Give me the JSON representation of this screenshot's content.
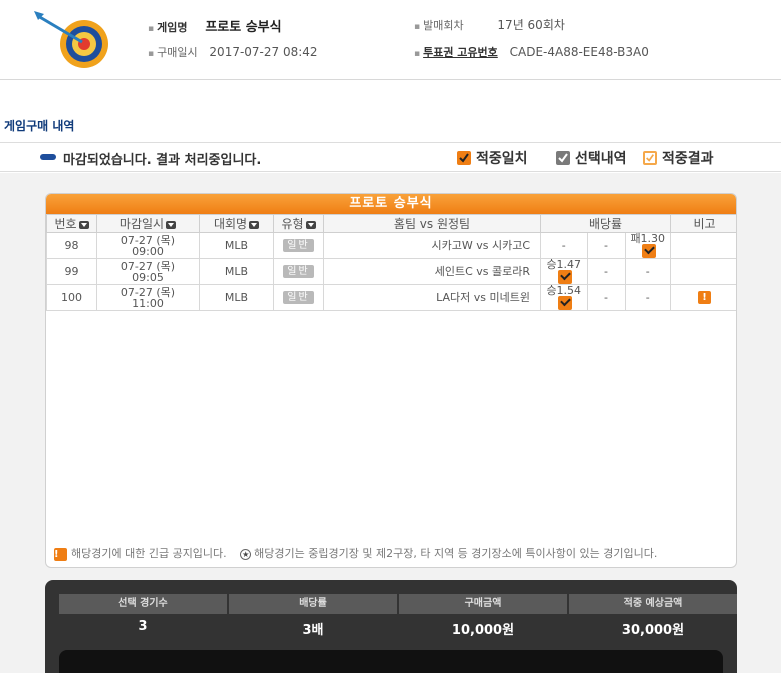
{
  "header": {
    "game_name_label": "게임명",
    "game_name_value": "프로토 승부식",
    "round_label": "발매회차",
    "round_value": "17년 60회차",
    "purchase_date_label": "구매일시",
    "purchase_date_value": "2017-07-27 08:42",
    "ticket_id_label": "투표권 고유번호",
    "ticket_id_value": "CADE-4A88-EE48-B3A0"
  },
  "section_title": "게임구매 내역",
  "status": {
    "text": "마감되었습니다. 결과 처리중입니다.",
    "legend": [
      {
        "label": "적중일치",
        "color": "#ef7e14",
        "style": "filled"
      },
      {
        "label": "선택내역",
        "color": "#7a7a7a",
        "style": "filled"
      },
      {
        "label": "적중결과",
        "color": "#f5a84a",
        "style": "outline"
      }
    ]
  },
  "table": {
    "title": "프로토 승부식",
    "columns": [
      "번호",
      "마감일시",
      "대회명",
      "유형",
      "홈팀 vs 원정팀",
      "배당률",
      "비고"
    ],
    "rows": [
      {
        "no": "98",
        "date": "07-27 (목)",
        "time": "09:00",
        "league": "MLB",
        "type": "일반",
        "match": "시카고W vs 시카고C",
        "odd_win": "-",
        "odd_draw": "-",
        "odd_lose": "패1.30",
        "checked": "lose",
        "note": ""
      },
      {
        "no": "99",
        "date": "07-27 (목)",
        "time": "09:05",
        "league": "MLB",
        "type": "일반",
        "match": "세인트C vs 콜로라R",
        "odd_win": "승1.47",
        "odd_draw": "-",
        "odd_lose": "-",
        "checked": "win",
        "note": ""
      },
      {
        "no": "100",
        "date": "07-27 (목)",
        "time": "11:00",
        "league": "MLB",
        "type": "일반",
        "match": "LA다저 vs 미네트윈",
        "odd_win": "승1.54",
        "odd_draw": "-",
        "odd_lose": "-",
        "checked": "win",
        "note": "!"
      }
    ]
  },
  "notice": {
    "urgent": "해당경기에 대한 긴급 공지입니다.",
    "neutral": "해당경기는 중립경기장 및 제2구장, 타 지역 등 경기장소에 특이사항이 있는 경기입니다."
  },
  "summary": {
    "labels": [
      "선택 경기수",
      "배당률",
      "구매금액",
      "적중 예상금액"
    ],
    "values": [
      "3",
      "3배",
      "10,000원",
      "30,000원"
    ]
  }
}
